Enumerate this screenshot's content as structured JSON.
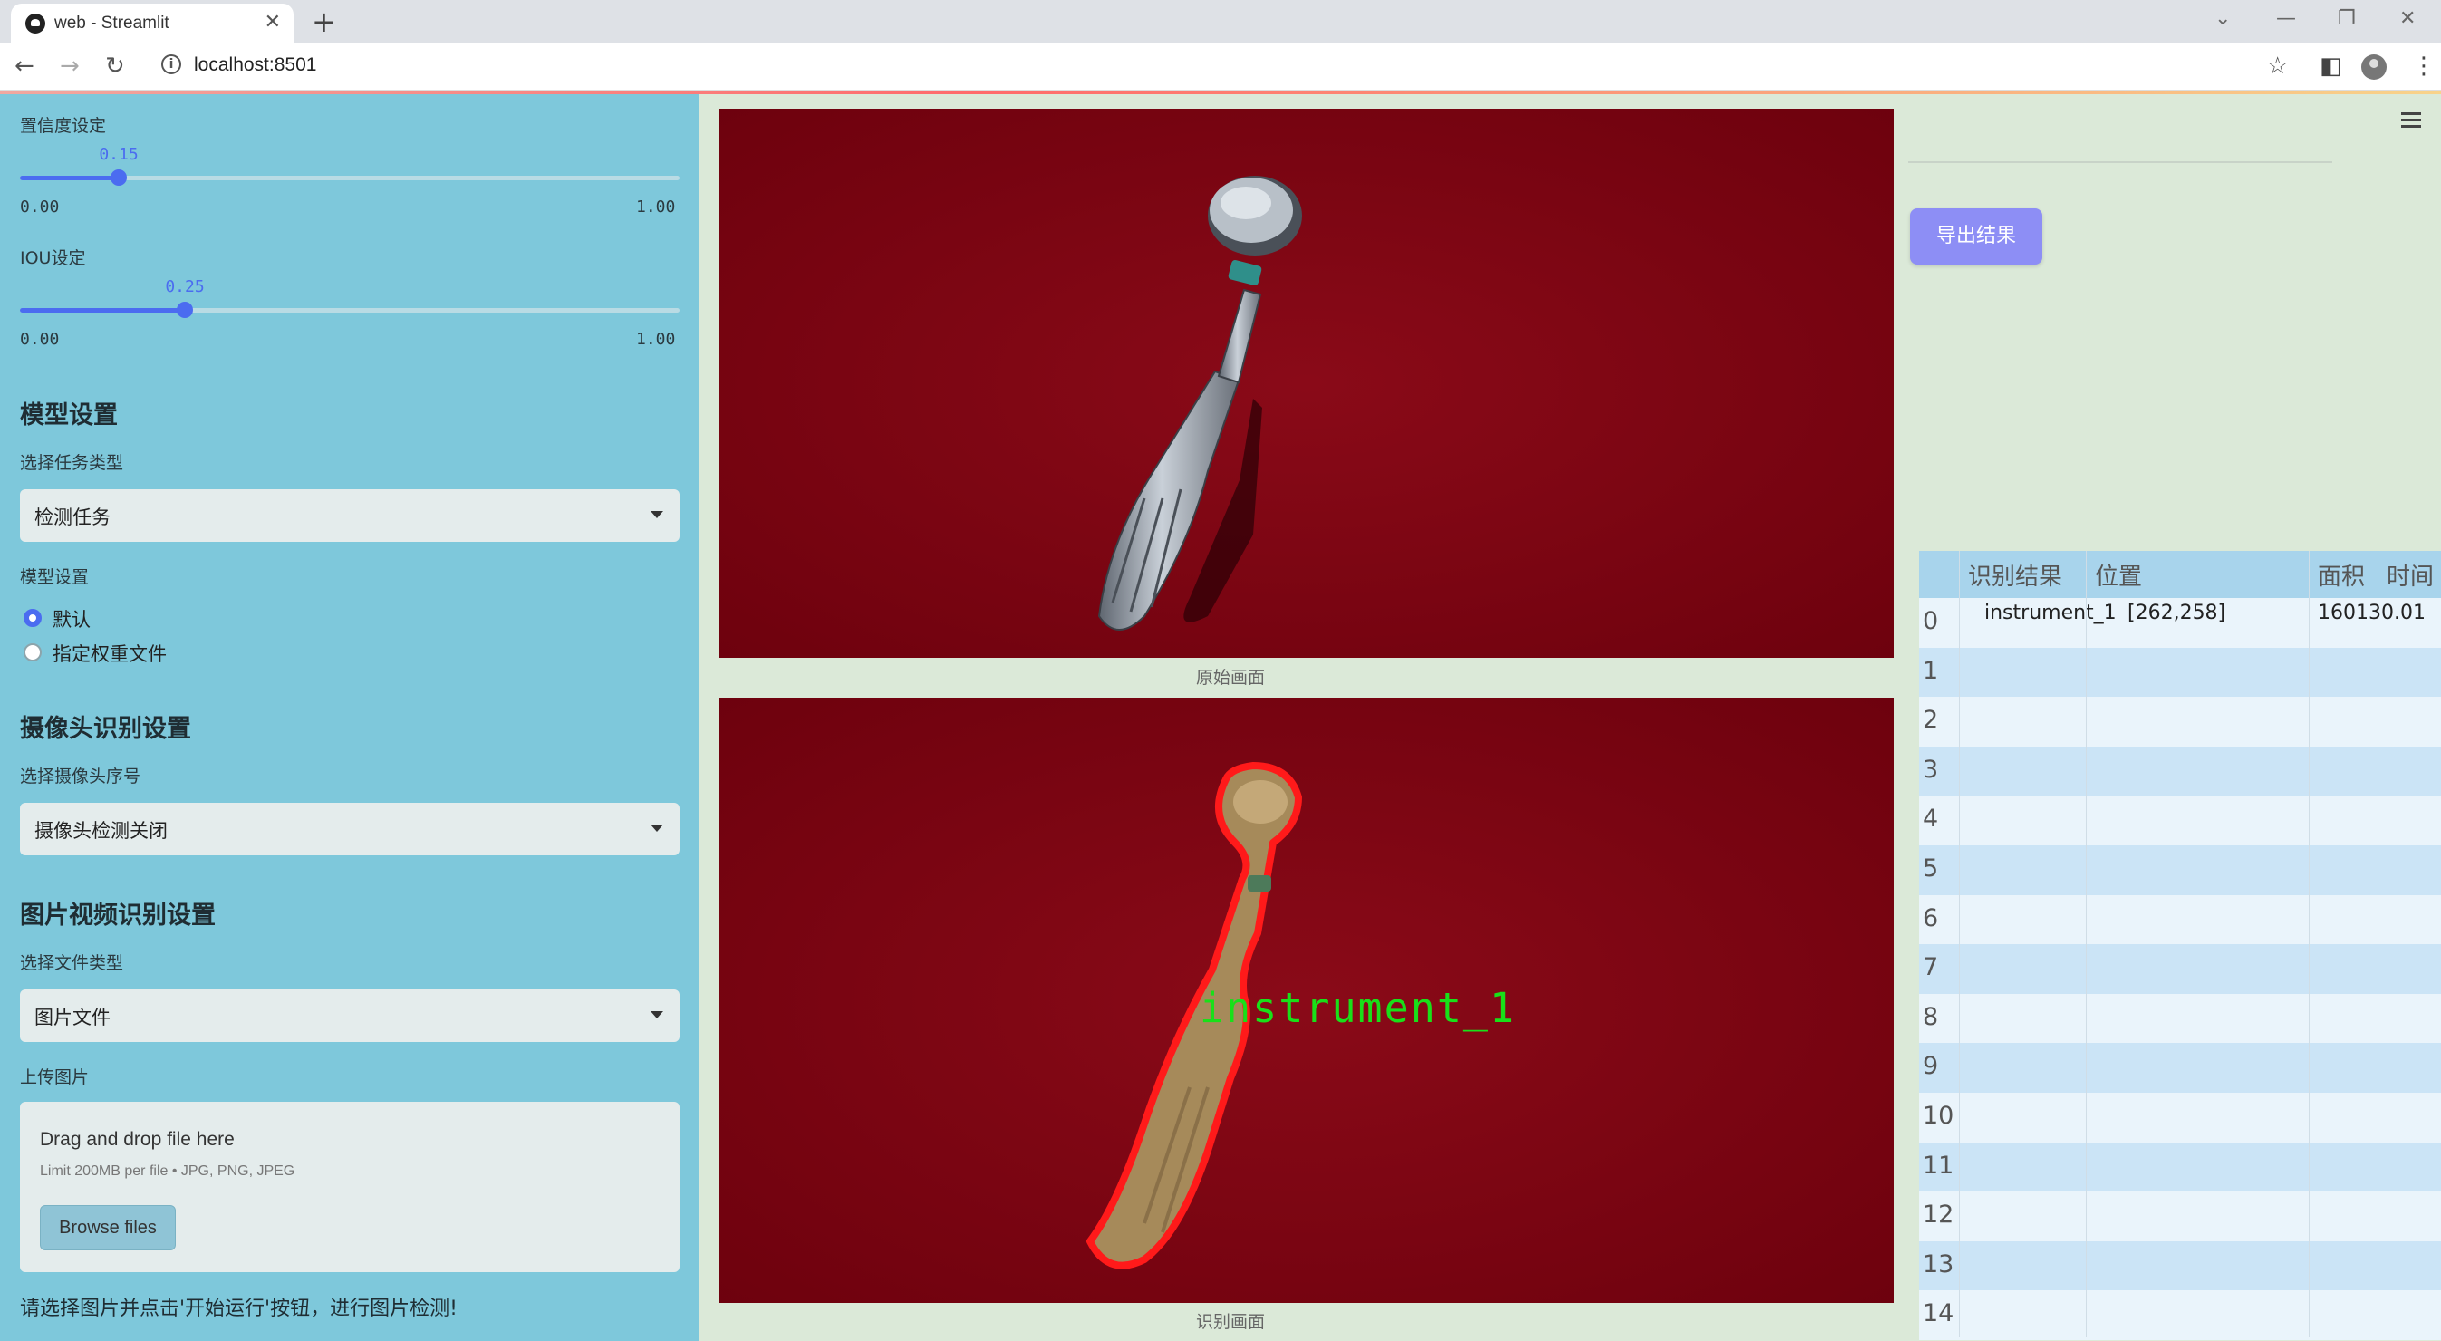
{
  "browser": {
    "tab_title": "web - Streamlit",
    "url": "localhost:8501"
  },
  "sidebar": {
    "confidence": {
      "label": "置信度设定",
      "value": "0.15",
      "value_fraction": 0.15,
      "min": "0.00",
      "max": "1.00"
    },
    "iou": {
      "label": "IOU设定",
      "value": "0.25",
      "value_fraction": 0.25,
      "min": "0.00",
      "max": "1.00"
    },
    "model_section": {
      "heading": "模型设置",
      "task_label": "选择任务类型",
      "task_value": "检测任务",
      "model_label": "模型设置",
      "options": [
        "默认",
        "指定权重文件"
      ],
      "selected": "默认"
    },
    "camera_section": {
      "heading": "摄像头识别设置",
      "camera_label": "选择摄像头序号",
      "camera_value": "摄像头检测关闭"
    },
    "media_section": {
      "heading": "图片视频识别设置",
      "file_type_label": "选择文件类型",
      "file_type_value": "图片文件",
      "upload_label": "上传图片",
      "drop_text": "Drag and drop file here",
      "limit_text": "Limit 200MB per file • JPG, PNG, JPEG",
      "browse_label": "Browse files"
    },
    "hint": "请选择图片并点击'开始运行'按钮，进行图片检测!"
  },
  "main": {
    "original_caption": "原始画面",
    "result_caption": "识别画面",
    "detection_label": "instrument_1"
  },
  "right": {
    "export_label": "导出结果",
    "table": {
      "headers": [
        "",
        "识别结果",
        "位置",
        "面积",
        "时间"
      ],
      "rows": [
        {
          "idx": "0",
          "result": "instrument_1",
          "position": "[262,258]",
          "area": "16013",
          "time": "0.01"
        },
        {
          "idx": "1"
        },
        {
          "idx": "2"
        },
        {
          "idx": "3"
        },
        {
          "idx": "4"
        },
        {
          "idx": "5"
        },
        {
          "idx": "6"
        },
        {
          "idx": "7"
        },
        {
          "idx": "8"
        },
        {
          "idx": "9"
        },
        {
          "idx": "10"
        },
        {
          "idx": "11"
        },
        {
          "idx": "12"
        },
        {
          "idx": "13"
        },
        {
          "idx": "14"
        }
      ]
    }
  },
  "colors": {
    "sidebar_bg": "#7ec8db",
    "slider_accent": "#4b6cf0",
    "image_bg": "#7a0010",
    "detection_green": "#19e019",
    "contour_red": "#ff1a1a",
    "export_button": "#8d8ef5"
  }
}
